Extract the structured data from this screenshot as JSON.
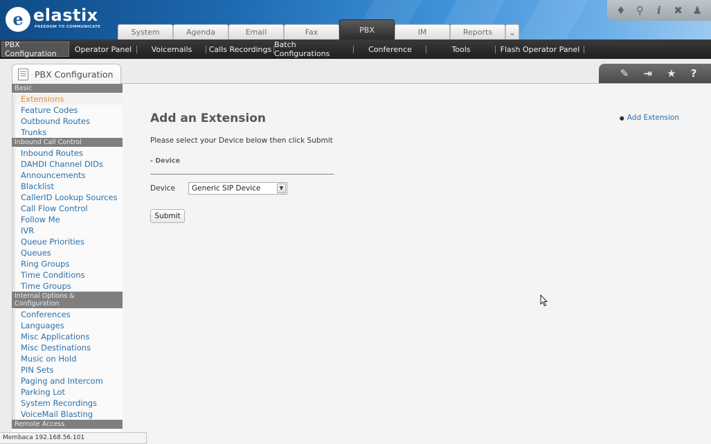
{
  "header": {
    "logo_text": "elastix",
    "logo_tagline": "FREEDOM TO COMMUNICATE",
    "main_tabs": [
      {
        "label": "System"
      },
      {
        "label": "Agenda"
      },
      {
        "label": "Email"
      },
      {
        "label": "Fax"
      },
      {
        "label": "PBX"
      },
      {
        "label": "IM"
      },
      {
        "label": "Reports"
      }
    ],
    "top_icons": [
      "flame-icon",
      "search-icon",
      "info-icon",
      "tools-icon",
      "user-icon"
    ]
  },
  "subnav": {
    "items": [
      {
        "label": "PBX Configuration"
      },
      {
        "label": "Operator Panel"
      },
      {
        "label": "Voicemails"
      },
      {
        "label": "Calls Recordings"
      },
      {
        "label": "Batch Configurations"
      },
      {
        "label": "Conference"
      },
      {
        "label": "Tools"
      },
      {
        "label": "Flash Operator Panel"
      }
    ]
  },
  "module": {
    "title": "PBX Configuration",
    "tools": [
      "edit-icon",
      "collapse-icon",
      "star-icon",
      "help-icon"
    ]
  },
  "sidebar": {
    "sections": [
      {
        "header": "Basic",
        "items": [
          "Extensions",
          "Feature Codes",
          "Outbound Routes",
          "Trunks"
        ]
      },
      {
        "header": "Inbound Call Control",
        "items": [
          "Inbound Routes",
          "DAHDI Channel DIDs",
          "Announcements",
          "Blacklist",
          "CallerID Lookup Sources",
          "Call Flow Control",
          "Follow Me",
          "IVR",
          "Queue Priorities",
          "Queues",
          "Ring Groups",
          "Time Conditions",
          "Time Groups"
        ]
      },
      {
        "header": "Internal Options & Configuration",
        "items": [
          "Conferences",
          "Languages",
          "Misc Applications",
          "Misc Destinations",
          "Music on Hold",
          "PIN Sets",
          "Paging and Intercom",
          "Parking Lot",
          "System Recordings",
          "VoiceMail Blasting"
        ]
      },
      {
        "header": "Remote Access",
        "items": []
      }
    ]
  },
  "content": {
    "heading": "Add an Extension",
    "quick_link": "Add Extension",
    "instruction": "Please select your Device below then click Submit",
    "section_label": "- Device",
    "device_label": "Device",
    "device_value": "Generic SIP Device",
    "submit_label": "Submit"
  },
  "statusbar": {
    "text": "Membaca 192.168.56.101"
  },
  "colors": {
    "active_item": "#f08a24",
    "link": "#2a70aa",
    "header_dark": "#0f4a86"
  }
}
